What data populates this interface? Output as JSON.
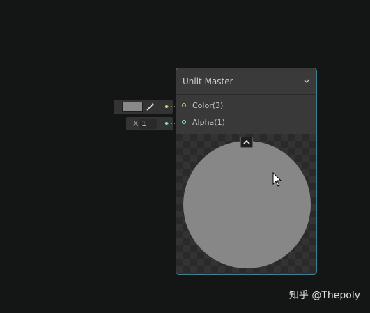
{
  "node": {
    "title": "Unlit Master",
    "ports": [
      {
        "label": "Color(3)",
        "color": "#d4d47a"
      },
      {
        "label": "Alpha(1)",
        "color": "#84e4e7"
      }
    ],
    "border_color": "#3f7f93"
  },
  "inputs": {
    "color_swatch": "#898989",
    "alpha_axis": "X",
    "alpha_value": "1"
  },
  "watermark": "知乎 @Thepoly"
}
